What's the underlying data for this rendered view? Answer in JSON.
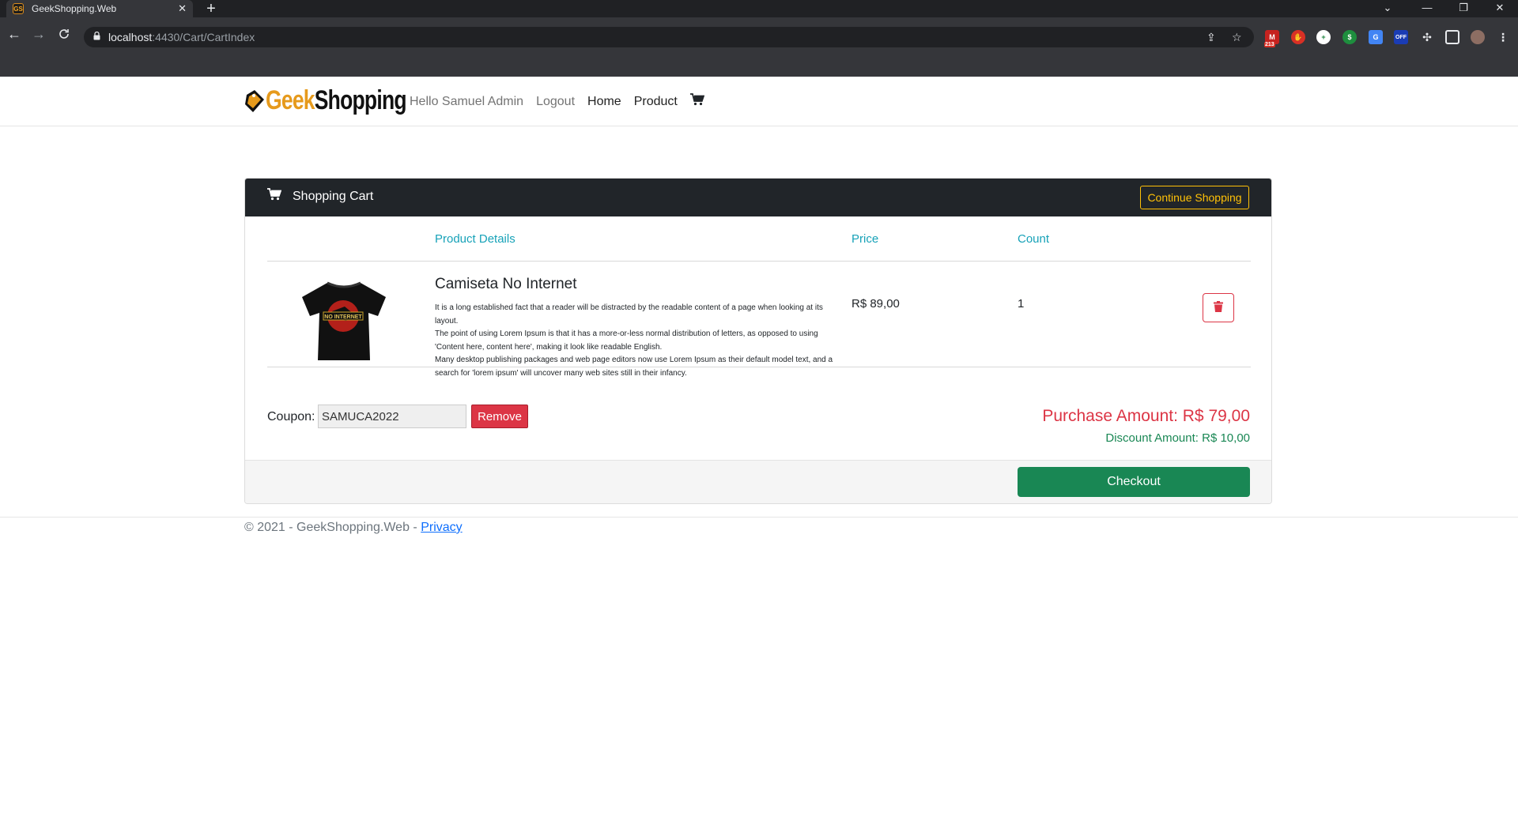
{
  "browser": {
    "tab_title": "GeekShopping.Web",
    "tab_close": "✕",
    "new_tab": "+",
    "url_host": "localhost",
    "url_path": ":4430/Cart/CartIndex",
    "extension_badge": "213",
    "extension_off_label": "OFF",
    "window_controls": [
      "⌄",
      "—",
      "❐",
      "✕"
    ]
  },
  "nav": {
    "brand_geek": "Geek",
    "brand_shopping": "Shopping",
    "greeting": "Hello Samuel Admin",
    "logout": "Logout",
    "home": "Home",
    "product": "Product"
  },
  "cart": {
    "title": "Shopping Cart",
    "continue_shopping": "Continue Shopping",
    "headers": {
      "product_details": "Product Details",
      "price": "Price",
      "count": "Count"
    },
    "items": [
      {
        "name": "Camiseta No Internet",
        "shirt_print": "NO INTERNET",
        "description_lines": [
          "It is a long established fact that a reader will be distracted by the readable content of a page when looking at its layout.",
          "The point of using Lorem Ipsum is that it has a more-or-less normal distribution of letters, as opposed to using 'Content here, content here', making it look like readable English.",
          "Many desktop publishing packages and web page editors now use Lorem Ipsum as their default model text, and a search for 'lorem ipsum' will uncover many web sites still in their infancy."
        ],
        "price": "R$ 89,00",
        "count": "1"
      }
    ],
    "coupon_label": "Coupon:",
    "coupon_value": "SAMUCA2022",
    "remove_label": "Remove",
    "purchase_amount": "Purchase Amount: R$ 79,00",
    "discount_amount": "Discount Amount: R$ 10,00",
    "checkout_label": "Checkout"
  },
  "footer": {
    "text": "© 2021 - GeekShopping.Web - ",
    "privacy": "Privacy"
  },
  "colors": {
    "header_dark": "#212529",
    "warning": "#ffc107",
    "info": "#17a2b8",
    "danger": "#dc3545",
    "success": "#198754"
  }
}
